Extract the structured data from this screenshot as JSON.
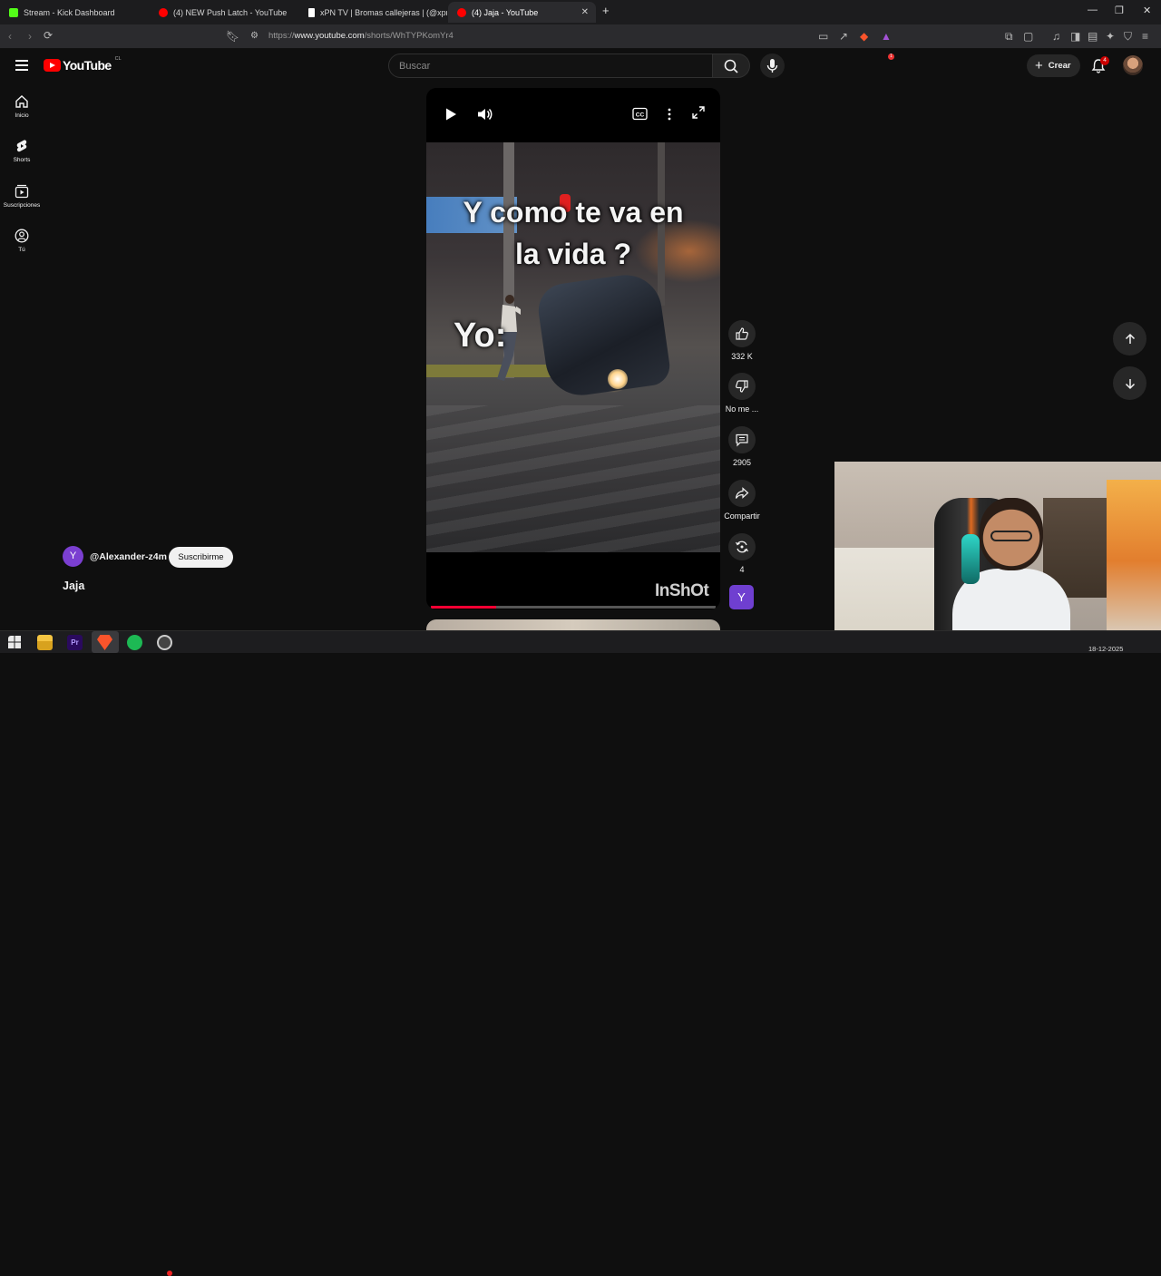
{
  "browser": {
    "tabs": [
      {
        "title": "Stream - Kick Dashboard",
        "favicon": "kick-icon",
        "color": "#53fc18"
      },
      {
        "title": "(4) NEW Push Latch - YouTube",
        "favicon": "youtube-icon",
        "color": "#ff0000"
      },
      {
        "title": "xPN TV | Bromas callejeras | (@xpn_o",
        "favicon": "tiktok-icon",
        "color": "#ffffff"
      },
      {
        "title": "(4) Jaja - YouTube",
        "favicon": "youtube-icon",
        "color": "#ff0000",
        "active": true
      }
    ],
    "new_tab": "+",
    "url_prefix": "https://",
    "url_host": "www.youtube.com",
    "url_path": "/shorts/WhTYPKomYr4",
    "ext_badge": "1"
  },
  "youtube": {
    "logo_text": "YouTube",
    "country_code": "CL",
    "search_placeholder": "Buscar",
    "create_label": "Crear",
    "notifications_count": "4"
  },
  "sidebar": {
    "items": [
      {
        "label": "Inicio",
        "icon": "home-icon"
      },
      {
        "label": "Shorts",
        "icon": "shorts-icon"
      },
      {
        "label": "Suscripciones",
        "icon": "subscriptions-icon"
      },
      {
        "label": "Tú",
        "icon": "user-icon"
      }
    ]
  },
  "short": {
    "overlay_line1": "Y como te va en",
    "overlay_line2": "la vida ?",
    "overlay_yo": "Yo:",
    "watermark": "InShOt",
    "progress": 0.23,
    "channel_handle": "@Alexander-z4m",
    "channel_initial": "Y",
    "subscribe_label": "Suscribirme",
    "title": "Jaja"
  },
  "actions": {
    "likes": "332 K",
    "dislike_label": "No me ...",
    "comments": "2905",
    "share_label": "Compartir",
    "remix_count": "4"
  },
  "taskbar": {
    "date": "18-12-2025"
  }
}
